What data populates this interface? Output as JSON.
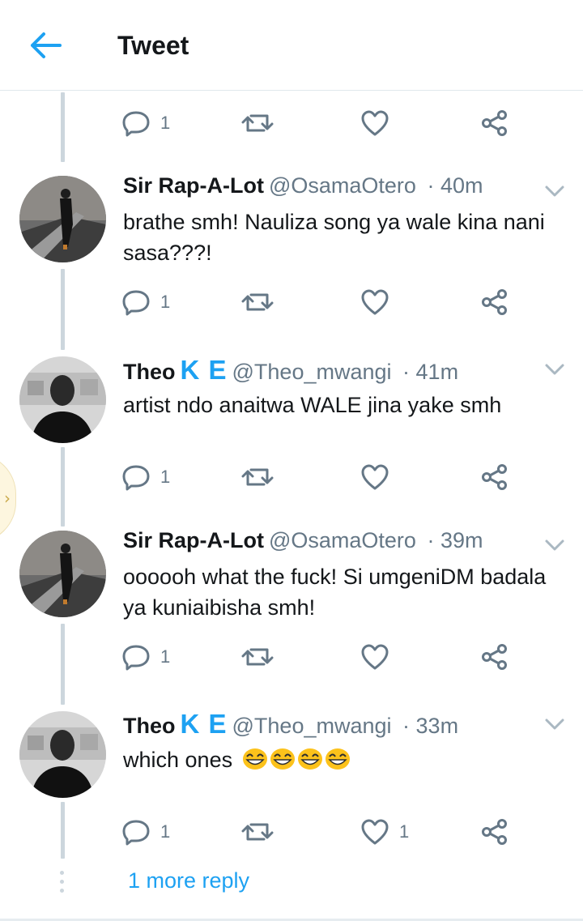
{
  "header": {
    "title": "Tweet",
    "back_icon": "arrow-left-icon"
  },
  "colors": {
    "accent": "#1da1f2",
    "muted": "#657786",
    "thread_line": "#ccd6dd",
    "text": "#14171a"
  },
  "top_actions": {
    "reply_count": "1",
    "retweet_count": "",
    "like_count": ""
  },
  "tweets": [
    {
      "name": "Sir Rap-A-Lot",
      "name_suffix": "",
      "handle": "@OsamaOtero",
      "time": "· 40m",
      "text": "brathe smh! Nauliza song ya wale kina nani sasa???!",
      "reply_count": "1",
      "retweet_count": "",
      "like_count": ""
    },
    {
      "name": "Theo",
      "name_suffix": "K E",
      "handle": "@Theo_mwangi",
      "time": "· 41m",
      "text": "artist ndo anaitwa WALE jina yake smh",
      "reply_count": "1",
      "retweet_count": "",
      "like_count": ""
    },
    {
      "name": "Sir Rap-A-Lot",
      "name_suffix": "",
      "handle": "@OsamaOtero",
      "time": "· 39m",
      "text": "oooooh what the fuck! Si umgeniDM badala ya kuniaibisha smh!",
      "reply_count": "1",
      "retweet_count": "",
      "like_count": ""
    },
    {
      "name": "Theo",
      "name_suffix": "K E",
      "handle": "@Theo_mwangi",
      "time": "· 33m",
      "text": "which ones",
      "emoji": [
        "grinning-face-emoji",
        "grinning-face-emoji",
        "grinning-face-emoji",
        "grinning-face-emoji"
      ],
      "reply_count": "1",
      "retweet_count": "",
      "like_count": "1"
    }
  ],
  "more_reply": "1 more reply"
}
